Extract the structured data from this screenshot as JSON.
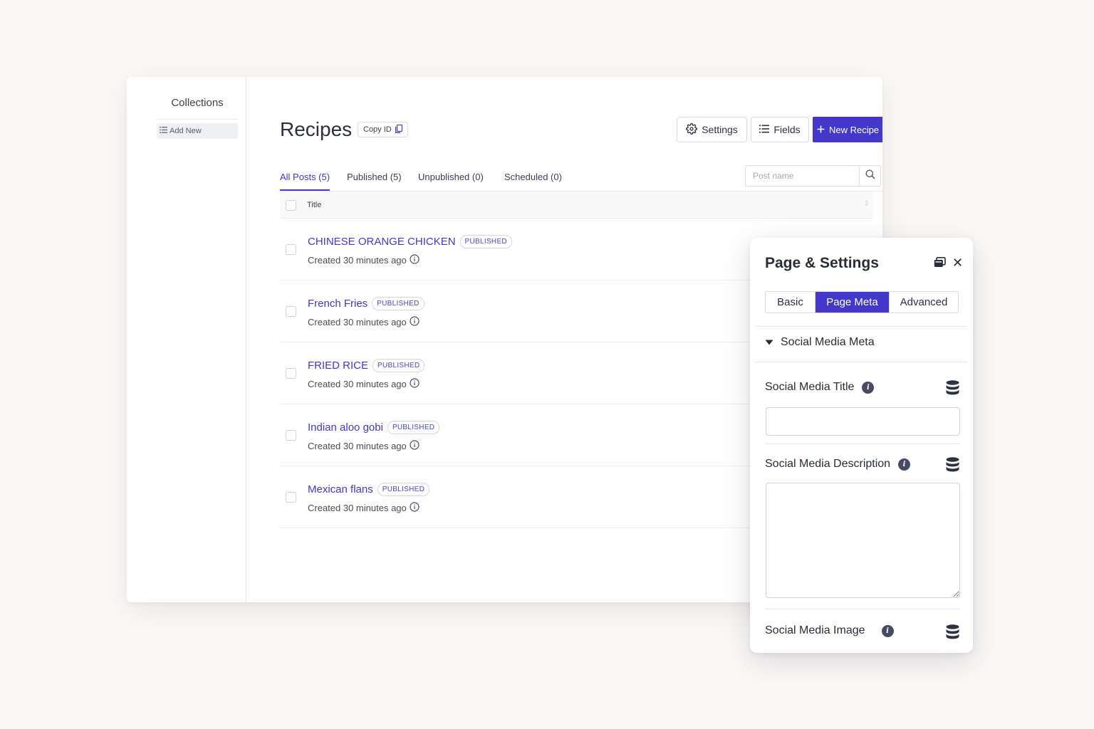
{
  "sidebar": {
    "title": "Collections",
    "add_new_label": "Add New"
  },
  "header": {
    "title": "Recipes",
    "copy_id_label": "Copy ID",
    "settings_label": "Settings",
    "fields_label": "Fields",
    "new_label": "New Recipe"
  },
  "tabs": [
    {
      "label": "All Posts (5)",
      "active": true
    },
    {
      "label": "Published (5)",
      "active": false
    },
    {
      "label": "Unpublished (0)",
      "active": false
    },
    {
      "label": "Scheduled (0)",
      "active": false
    }
  ],
  "search": {
    "placeholder": "Post name",
    "value": ""
  },
  "table": {
    "column_title": "Title",
    "rows": [
      {
        "title": "CHINESE ORANGE CHICKEN",
        "status": "PUBLISHED",
        "meta": "Created 30 minutes ago"
      },
      {
        "title": "French Fries",
        "status": "PUBLISHED",
        "meta": "Created 30 minutes ago"
      },
      {
        "title": "FRIED RICE",
        "status": "PUBLISHED",
        "meta": "Created 30 minutes ago"
      },
      {
        "title": "Indian aloo gobi",
        "status": "PUBLISHED",
        "meta": "Created 30 minutes ago"
      },
      {
        "title": "Mexican flans",
        "status": "PUBLISHED",
        "meta": "Created 30 minutes ago"
      }
    ]
  },
  "panel": {
    "title": "Page & Settings",
    "segments": [
      {
        "label": "Basic",
        "active": false
      },
      {
        "label": "Page Meta",
        "active": true
      },
      {
        "label": "Advanced",
        "active": false
      }
    ],
    "section_label": "Social Media Meta",
    "fields": {
      "title_label": "Social Media Title",
      "title_value": "",
      "description_label": "Social Media Description",
      "description_value": "",
      "image_label": "Social Media Image"
    }
  },
  "colors": {
    "accent": "#4338ca",
    "background": "#fbf9f7",
    "info_icon": "#464a63"
  },
  "icons": [
    "list-icon",
    "copy-icon",
    "gear-icon",
    "list-icon",
    "plus-icon",
    "search-icon",
    "info-circle-icon",
    "dock-icon",
    "close-icon",
    "caret-down-icon",
    "info-icon",
    "database-icon"
  ]
}
